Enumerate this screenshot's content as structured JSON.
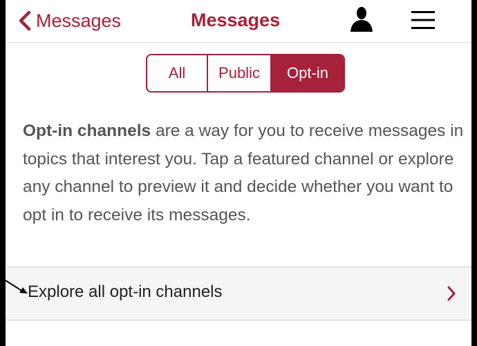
{
  "nav": {
    "back_label": "Messages",
    "title": "Messages",
    "back_icon": "chevron-left-icon",
    "profile_icon": "person-icon",
    "menu_icon": "hamburger-menu-icon"
  },
  "segmented": {
    "tabs": [
      {
        "label": "All",
        "selected": false
      },
      {
        "label": "Public",
        "selected": false
      },
      {
        "label": "Opt-in",
        "selected": true
      }
    ]
  },
  "description": {
    "bold_lead": "Opt-in channels",
    "rest": " are a way for you to receive messages in topics that interest you. Tap a featured channel or explore any channel to preview it and decide whether you want to opt in to receive its messages."
  },
  "explore": {
    "label": "Explore all opt-in channels",
    "icon": "chevron-right-icon"
  },
  "colors": {
    "accent": "#a6213a",
    "text_gray": "#555555",
    "row_bg": "#f5f5f5"
  }
}
